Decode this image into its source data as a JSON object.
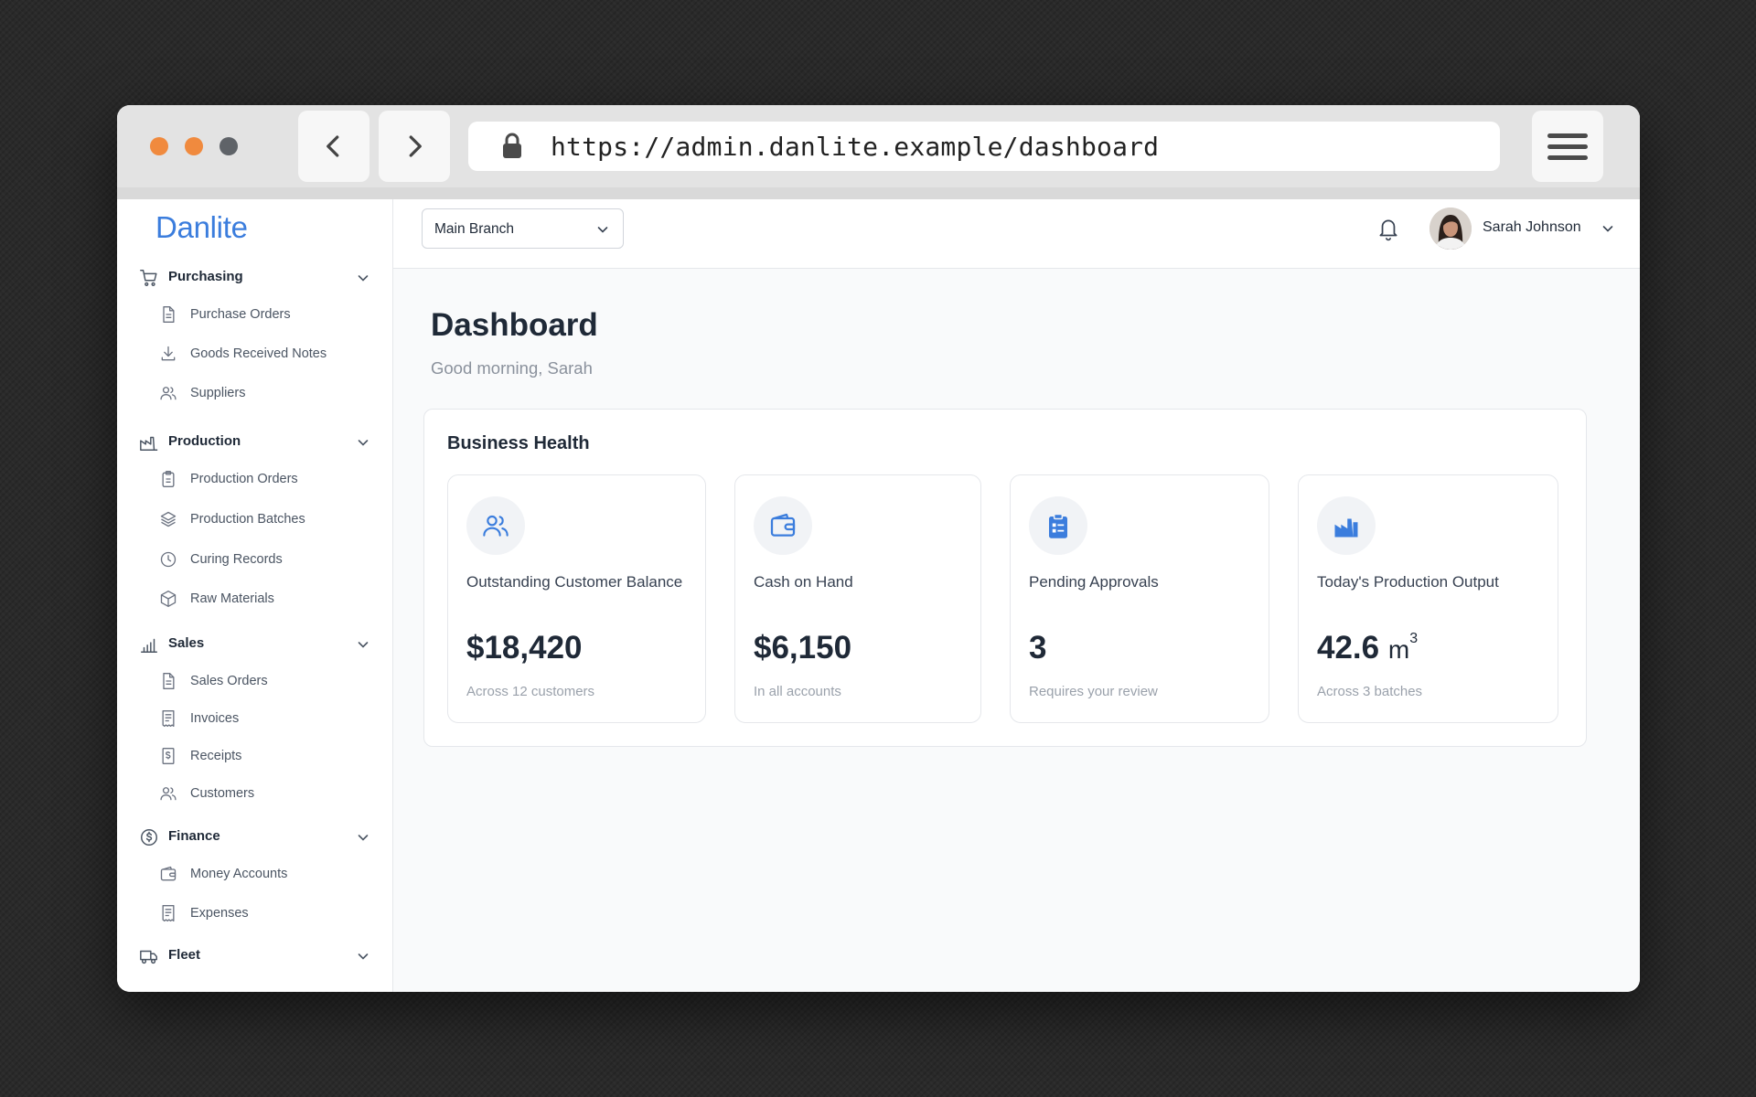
{
  "browser": {
    "url": "https://admin.danlite.example/dashboard"
  },
  "brand": {
    "name": "Danlite",
    "color": "#3b7ddd"
  },
  "sidebar": {
    "sections": [
      {
        "label": "Purchasing",
        "icon": "cart-icon",
        "items": [
          {
            "label": "Purchase Orders",
            "icon": "document-icon"
          },
          {
            "label": "Goods Received Notes",
            "icon": "download-icon"
          },
          {
            "label": "Suppliers",
            "icon": "users-icon"
          }
        ]
      },
      {
        "label": "Production",
        "icon": "factory-icon",
        "items": [
          {
            "label": "Production Orders",
            "icon": "clipboard-icon"
          },
          {
            "label": "Production Batches",
            "icon": "layers-icon"
          },
          {
            "label": "Curing Records",
            "icon": "clock-icon"
          },
          {
            "label": "Raw Materials",
            "icon": "cube-icon"
          }
        ]
      },
      {
        "label": "Sales",
        "icon": "bar-chart-icon",
        "items": [
          {
            "label": "Sales Orders",
            "icon": "document-icon"
          },
          {
            "label": "Invoices",
            "icon": "invoice-icon"
          },
          {
            "label": "Receipts",
            "icon": "receipt-icon"
          },
          {
            "label": "Customers",
            "icon": "users-icon"
          }
        ]
      },
      {
        "label": "Finance",
        "icon": "dollar-circle-icon",
        "items": [
          {
            "label": "Money Accounts",
            "icon": "wallet-icon"
          },
          {
            "label": "Expenses",
            "icon": "invoice-icon"
          }
        ]
      },
      {
        "label": "Fleet",
        "icon": "truck-icon",
        "items": []
      }
    ]
  },
  "topbar": {
    "branch": "Main Branch",
    "user_name": "Sarah Johnson"
  },
  "page": {
    "title": "Dashboard",
    "greeting": "Good morning, Sarah"
  },
  "health": {
    "title": "Business Health",
    "cards": [
      {
        "label": "Outstanding Customer Balance",
        "value": "$18,420",
        "sub": "Across 12 customers",
        "icon": "users-icon"
      },
      {
        "label": "Cash on Hand",
        "value": "$6,150",
        "sub": "In all accounts",
        "icon": "wallet-icon"
      },
      {
        "label": "Pending Approvals",
        "value": "3",
        "sub": "Requires your review",
        "icon": "clipboard-list-icon"
      },
      {
        "label": "Today's Production Output",
        "value": "42.6",
        "unit": "m",
        "unit_sup": "3",
        "sub": "Across 3 batches",
        "icon": "factory-icon"
      }
    ]
  },
  "colors": {
    "accent": "#3b7ddd",
    "text": "#1f2937",
    "muted": "#9aa1ab"
  }
}
